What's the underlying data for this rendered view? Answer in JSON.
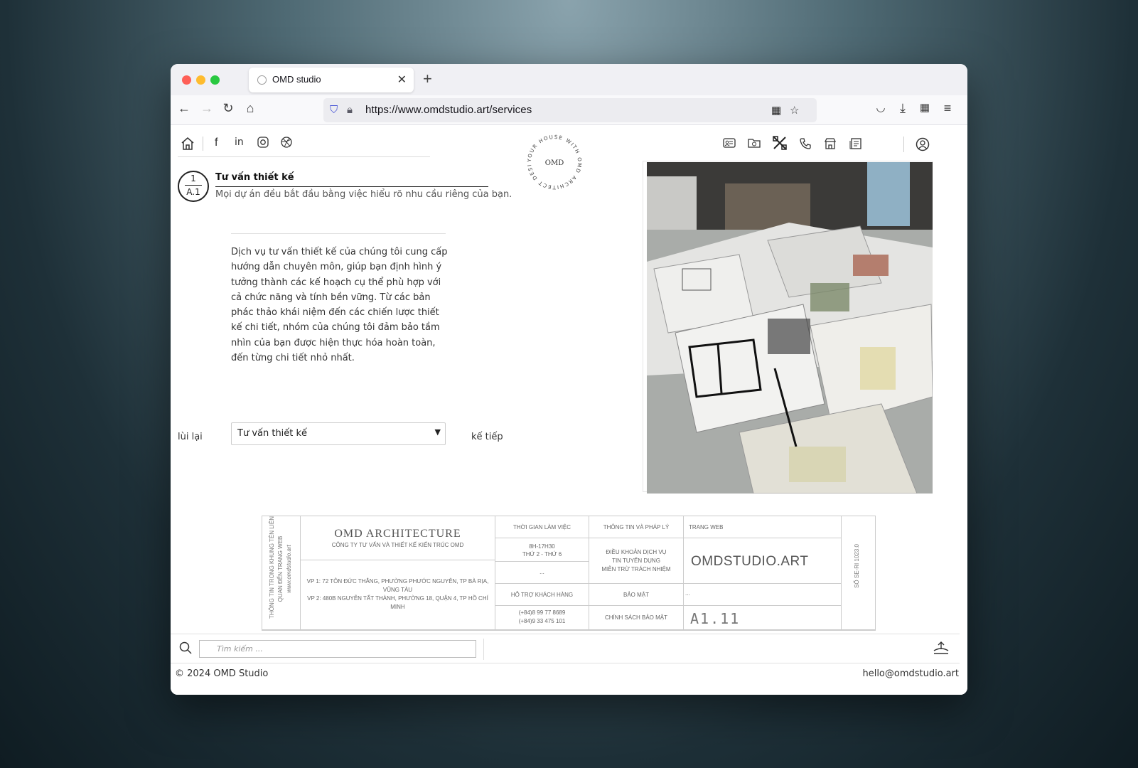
{
  "browser": {
    "tab_title": "OMD studio",
    "url": "https://www.omdstudio.art/services",
    "tab_close": "✕",
    "new_tab": "+"
  },
  "service": {
    "number_top": "1",
    "number_bottom": "A.1",
    "title": "Tư vấn thiết kế",
    "subtitle": "Mọi dự án đều bắt đầu bằng việc hiểu rõ nhu cầu riêng của bạn.",
    "description": "Dịch vụ tư vấn thiết kế của chúng tôi cung cấp hướng dẫn chuyên môn, giúp bạn định hình ý tưởng thành các kế hoạch cụ thể phù hợp với cả chức năng và tính bền vững. Từ các bản phác thảo khái niệm đến các chiến lược thiết kế chi tiết, nhóm của chúng tôi đảm bảo tầm nhìn của bạn được hiện thực hóa hoàn toàn, đến từng chi tiết nhỏ nhất."
  },
  "pager": {
    "prev": "lùi lại",
    "next": "kế tiếp",
    "selected": "Tư vấn thiết kế"
  },
  "seal": {
    "center": "OMD",
    "ring_text": "YOUR HOUSE WITH OMD ARCHITECT DESIGN"
  },
  "title_block": {
    "vertical_left_1": "THÔNG TIN TRONG KHUNG TÊN LIÊN",
    "vertical_left_2": "QUAN ĐẾN TRANG WEB",
    "vertical_left_3": "www.omdstudio.art",
    "company": "OMD ARCHITECTURE",
    "company_sub": "CÔNG TY TƯ VẤN VÀ THIẾT KẾ KIẾN TRÚC OMD",
    "address_1": "VP 1: 72 TÔN ĐỨC THẮNG, PHƯỜNG PHƯỚC NGUYÊN, TP BÀ RỊA, VŨNG TÀU",
    "address_2": "VP 2: 480B NGUYỄN TẤT THÀNH, PHƯỜNG 18, QUẬN 4, TP HỒ CHÍ MINH",
    "hours_label": "THỜI GIAN LÀM VIỆC",
    "hours_1": "8H-17H30",
    "hours_2": "THỨ 2 - THỨ 6",
    "dots": "...",
    "support_label": "HỖ TRỢ KHÁCH HÀNG",
    "phone_1": "(+84)8 99 77 8689",
    "phone_2": "(+84)9 33 475 101",
    "legal_label": "THÔNG TIN VÀ PHÁP LÝ",
    "legal_1": "ĐIỀU KHOẢN DỊCH VỤ",
    "legal_2": "TIN TUYỂN DỤNG",
    "legal_3": "MIỄN TRỪ TRÁCH NHIỆM",
    "security": "BẢO MẬT",
    "privacy": "CHÍNH SÁCH BẢO MẬT",
    "web_label": "TRANG WEB",
    "web_value": "OMDSTUDIO.ART",
    "dots2": "...",
    "sheet": "A1.11",
    "version": "SỐ SE-RI 1023.0"
  },
  "bottom": {
    "search_placeholder": "Tìm kiếm ...",
    "copyright": "© 2024 OMD Studio",
    "email": "hello@omdstudio.art"
  }
}
